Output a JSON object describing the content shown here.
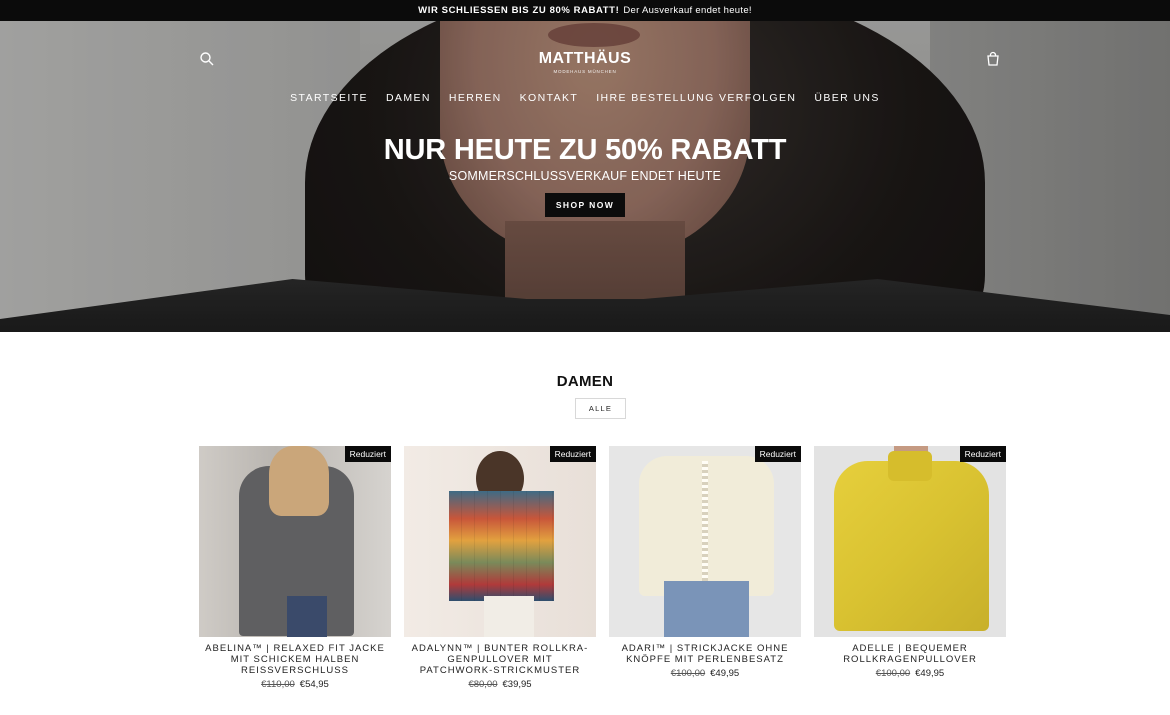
{
  "announcement": {
    "bold": "WIR SCHLIESSEN BIS ZU 80% RABATT!",
    "text": "Der Ausverkauf endet heute!"
  },
  "header": {
    "logo": "MATTHÄUS",
    "logo_sub": "MODEHAUS MÜNCHEN",
    "icons": [
      "search-icon",
      "cart-icon"
    ],
    "nav": [
      "STARTSEITE",
      "DAMEN",
      "HERREN",
      "KONTAKT",
      "IHRE BESTELLUNG VERFOLGEN",
      "ÜBER UNS"
    ]
  },
  "hero": {
    "title": "NUR HEUTE ZU 50% RABATT",
    "subtitle": "SOMMERSCHLUSSVERKAUF ENDET HEUTE",
    "cta": "SHOP NOW"
  },
  "collection": {
    "title": "DAMEN",
    "all_button": "ALLE",
    "products": [
      {
        "badge": "Reduziert",
        "name": "ABELINA™ | RELAXED FIT JACKE MIT SCHICKEM HALBEN REISSVERSCHLUSS",
        "old_price": "€110,00",
        "price": "€54,95"
      },
      {
        "badge": "Reduziert",
        "name": "ADALYNN™ | BUNTER ROLLKRA-GENPULLOVER MIT PATCHWORK-STRICKMUSTER",
        "old_price": "€80,00",
        "price": "€39,95"
      },
      {
        "badge": "Reduziert",
        "name": "ADARI™ | STRICKJACKE OHNE KNÖPFE MIT PERLENBESATZ",
        "old_price": "€100,00",
        "price": "€49,95"
      },
      {
        "badge": "Reduziert",
        "name": "ADELLE | BEQUEMER ROLLKRAGENPULLOVER",
        "old_price": "€100,00",
        "price": "€49,95"
      }
    ]
  },
  "colors": {
    "announcement_bg": "#0b0b0b",
    "button_bg": "#0c0c0c",
    "badge_bg": "#0a0a0a"
  }
}
